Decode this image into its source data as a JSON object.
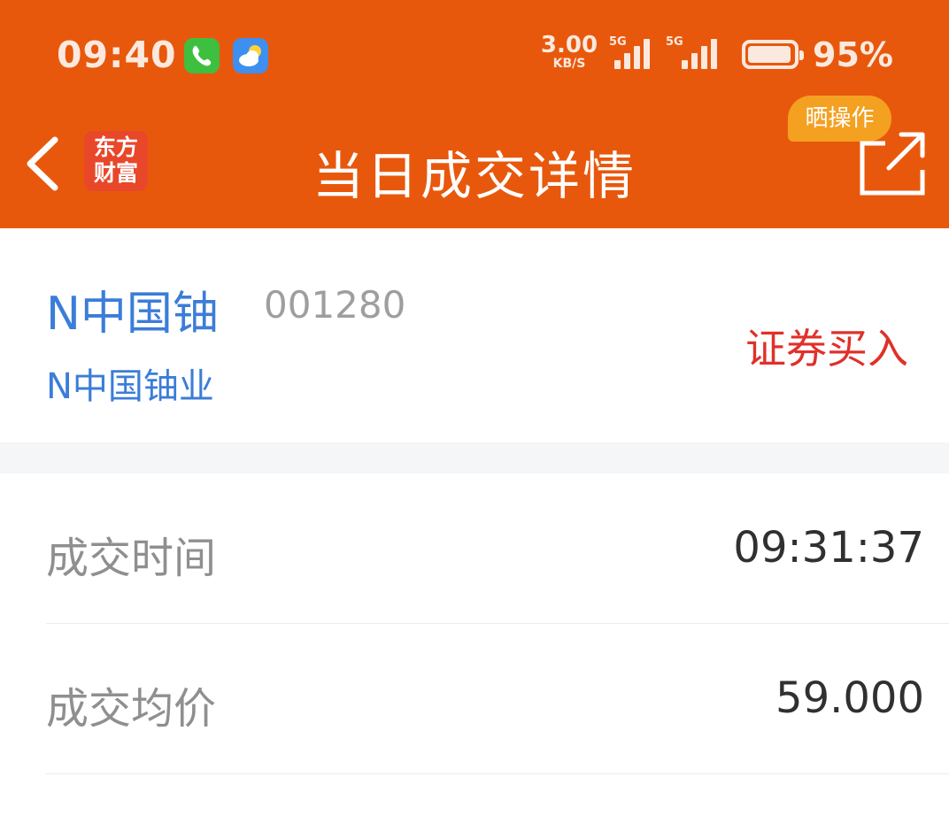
{
  "status_bar": {
    "time": "09:40",
    "net_speed_value": "3.00",
    "net_speed_unit": "KB/S",
    "signal1_tag": "5G",
    "signal2_tag": "5G",
    "battery_percent": "95%",
    "battery_level": 0.95
  },
  "nav": {
    "logo_line1": "东方",
    "logo_line2": "财富",
    "title": "当日成交详情",
    "share_badge": "晒操作"
  },
  "stock": {
    "name": "N中国铀",
    "code": "001280",
    "full_name": "N中国铀业",
    "trade_type": "证券买入"
  },
  "details": [
    {
      "label": "成交时间",
      "value": "09:31:37"
    },
    {
      "label": "成交均价",
      "value": "59.000"
    }
  ],
  "colors": {
    "header": "#e8580c",
    "stock_name": "#3b7dd8",
    "trade_type": "#e0302a",
    "badge": "#f4a021"
  }
}
